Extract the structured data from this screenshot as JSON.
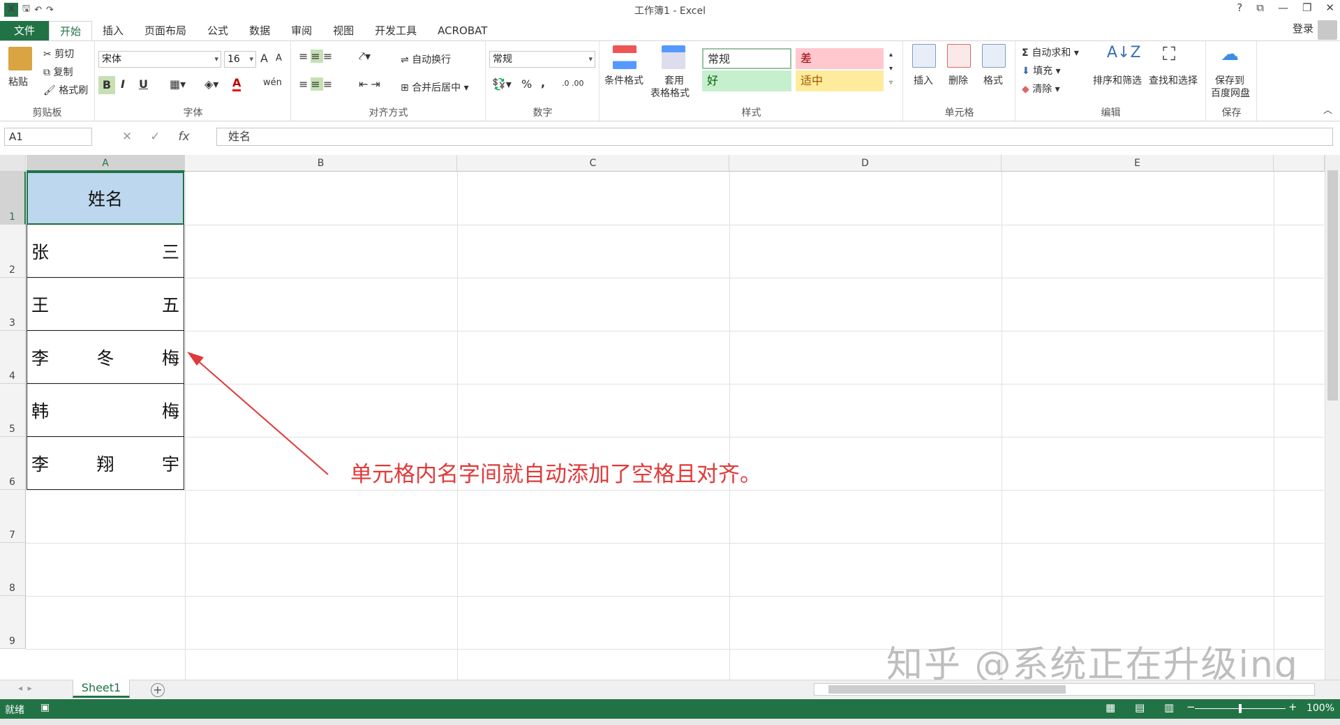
{
  "window": {
    "title": "工作簿1 - Excel",
    "controls": [
      "?",
      "⧉",
      "—",
      "❐",
      "✕"
    ]
  },
  "qat": {
    "save": "🖫",
    "undo": "↶",
    "redo": "↷"
  },
  "tabs": [
    "文件",
    "开始",
    "插入",
    "页面布局",
    "公式",
    "数据",
    "审阅",
    "视图",
    "开发工具",
    "ACROBAT"
  ],
  "active_tab": "开始",
  "account": {
    "login": "登录"
  },
  "ribbon": {
    "clipboard": {
      "paste": "粘贴",
      "cut": "剪切",
      "copy": "复制",
      "format_painter": "格式刷",
      "label": "剪贴板"
    },
    "font": {
      "name": "宋体",
      "size": "16",
      "bold": "B",
      "italic": "I",
      "underline": "U",
      "grow": "A",
      "shrink": "A",
      "label": "字体"
    },
    "alignment": {
      "wrap": "自动换行",
      "merge": "合并后居中",
      "label": "对齐方式"
    },
    "number": {
      "format": "常规",
      "percent": "%",
      "comma": ",",
      "label": "数字"
    },
    "styles": {
      "conditional": "条件格式",
      "table1": "套用",
      "table2": "表格格式",
      "normal": "常规",
      "bad": "差",
      "good": "好",
      "neutral": "适中",
      "label": "样式"
    },
    "cells": {
      "insert": "插入",
      "delete": "删除",
      "format": "格式",
      "label": "单元格"
    },
    "editing": {
      "autosum": "自动求和",
      "fill": "填充",
      "clear": "清除",
      "sort": "排序和筛选",
      "find": "查找和选择",
      "label": "编辑"
    },
    "save": {
      "save1": "保存到",
      "save2": "百度网盘",
      "label": "保存"
    }
  },
  "formula_bar": {
    "name_box": "A1",
    "fx": "fx",
    "cancel": "✕",
    "enter": "✓",
    "value": "姓名"
  },
  "columns": [
    "A",
    "B",
    "C",
    "D",
    "E"
  ],
  "rows": [
    "1",
    "2",
    "3",
    "4",
    "5",
    "6",
    "7",
    "8",
    "9"
  ],
  "cells": {
    "A1": "姓名",
    "A2": [
      "张",
      "三"
    ],
    "A3": [
      "王",
      "五"
    ],
    "A4": [
      "李",
      "冬",
      "梅"
    ],
    "A5": [
      "韩",
      "梅"
    ],
    "A6": [
      "李",
      "翔",
      "宇"
    ]
  },
  "annotation": "单元格内名字间就自动添加了空格且对齐。",
  "watermark": "知乎 @系统正在升级ing",
  "sheets": [
    "Sheet1"
  ],
  "add_sheet": "+",
  "status": {
    "ready": "就绪",
    "zoom": "100%"
  },
  "colors": {
    "excel_green": "#217346",
    "header_fill": "#bdd7ee",
    "annotation": "#e03a3a"
  }
}
